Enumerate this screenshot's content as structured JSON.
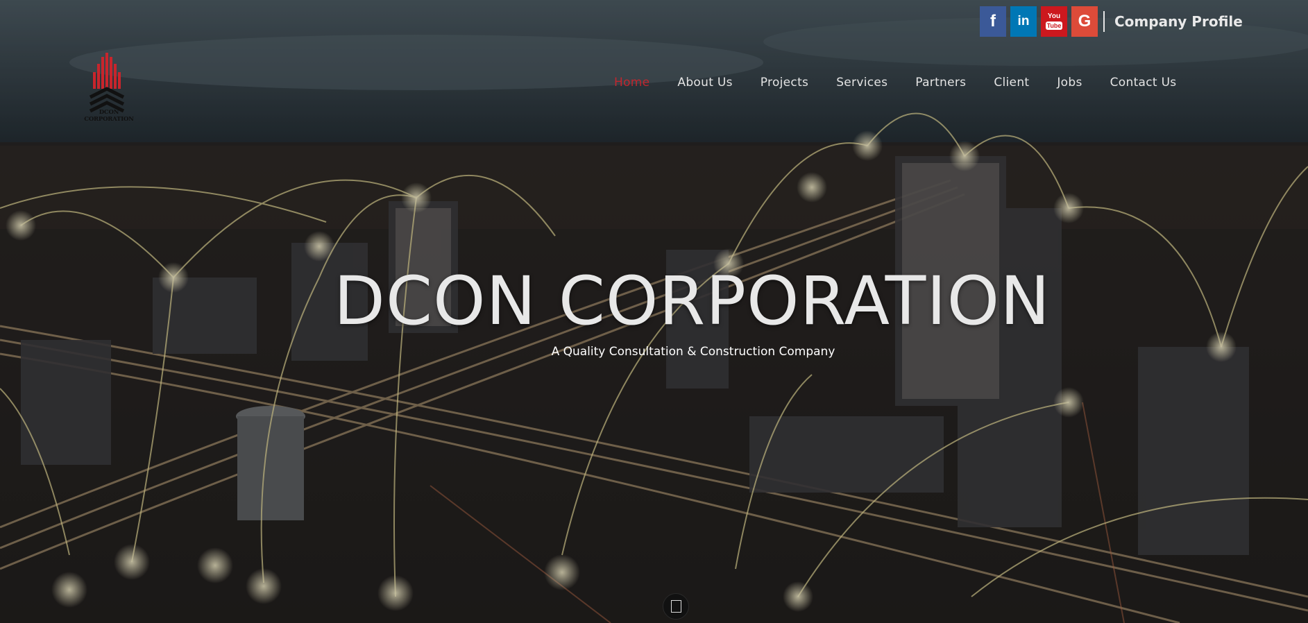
{
  "social": {
    "facebook_icon": "facebook-icon",
    "linkedin_icon": "linkedin-icon",
    "youtube_icon": "youtube-icon",
    "google_icon": "google-plus-icon",
    "facebook_glyph": "f",
    "linkedin_glyph": "in",
    "youtube_glyph_top": "You",
    "youtube_glyph_bottom": "Tube",
    "google_glyph": "G",
    "company_profile": "Company Profile"
  },
  "logo": {
    "text": "DCON CORPORATION",
    "colors": {
      "bars": "#c8252c",
      "chevrons": "#111111"
    }
  },
  "nav": {
    "items": [
      {
        "label": "Home",
        "active": true
      },
      {
        "label": "About Us",
        "active": false
      },
      {
        "label": "Projects",
        "active": false
      },
      {
        "label": "Services",
        "active": false
      },
      {
        "label": "Partners",
        "active": false
      },
      {
        "label": "Client",
        "active": false
      },
      {
        "label": "Jobs",
        "active": false
      },
      {
        "label": "Contact Us",
        "active": false
      }
    ],
    "active_color": "#c0262e"
  },
  "hero": {
    "title": "DCON CORPORATION",
    "subtitle": "A Quality Consultation & Construction Company"
  },
  "scroll_button": {
    "icon": "scroll-down-icon"
  },
  "colors": {
    "facebook": "#3b5998",
    "linkedin": "#0077b5",
    "youtube": "#cc181e",
    "google": "#dd4b39"
  }
}
